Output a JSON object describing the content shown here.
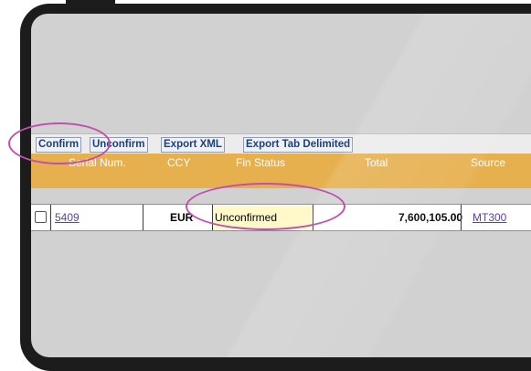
{
  "toolbar": {
    "buttons": [
      {
        "label": "Confirm"
      },
      {
        "label": "Unconfirm"
      },
      {
        "label": "Export XML"
      },
      {
        "label": "Export Tab Delimited"
      }
    ]
  },
  "table": {
    "columns": [
      "Serial Num.",
      "CCY",
      "Fin Status",
      "Total",
      "Source"
    ],
    "rows": [
      {
        "serial": "5409",
        "ccy": "EUR",
        "fin_status": "Unconfirmed",
        "total": "7,600,105.00",
        "source": "MT300"
      }
    ]
  },
  "colors": {
    "header_bg": "#e6b04f",
    "screen_bg": "#d1d1d1",
    "highlight_circle": "#c04fb0",
    "status_cell_bg": "#fff9c9",
    "link": "#5a3fb0"
  }
}
